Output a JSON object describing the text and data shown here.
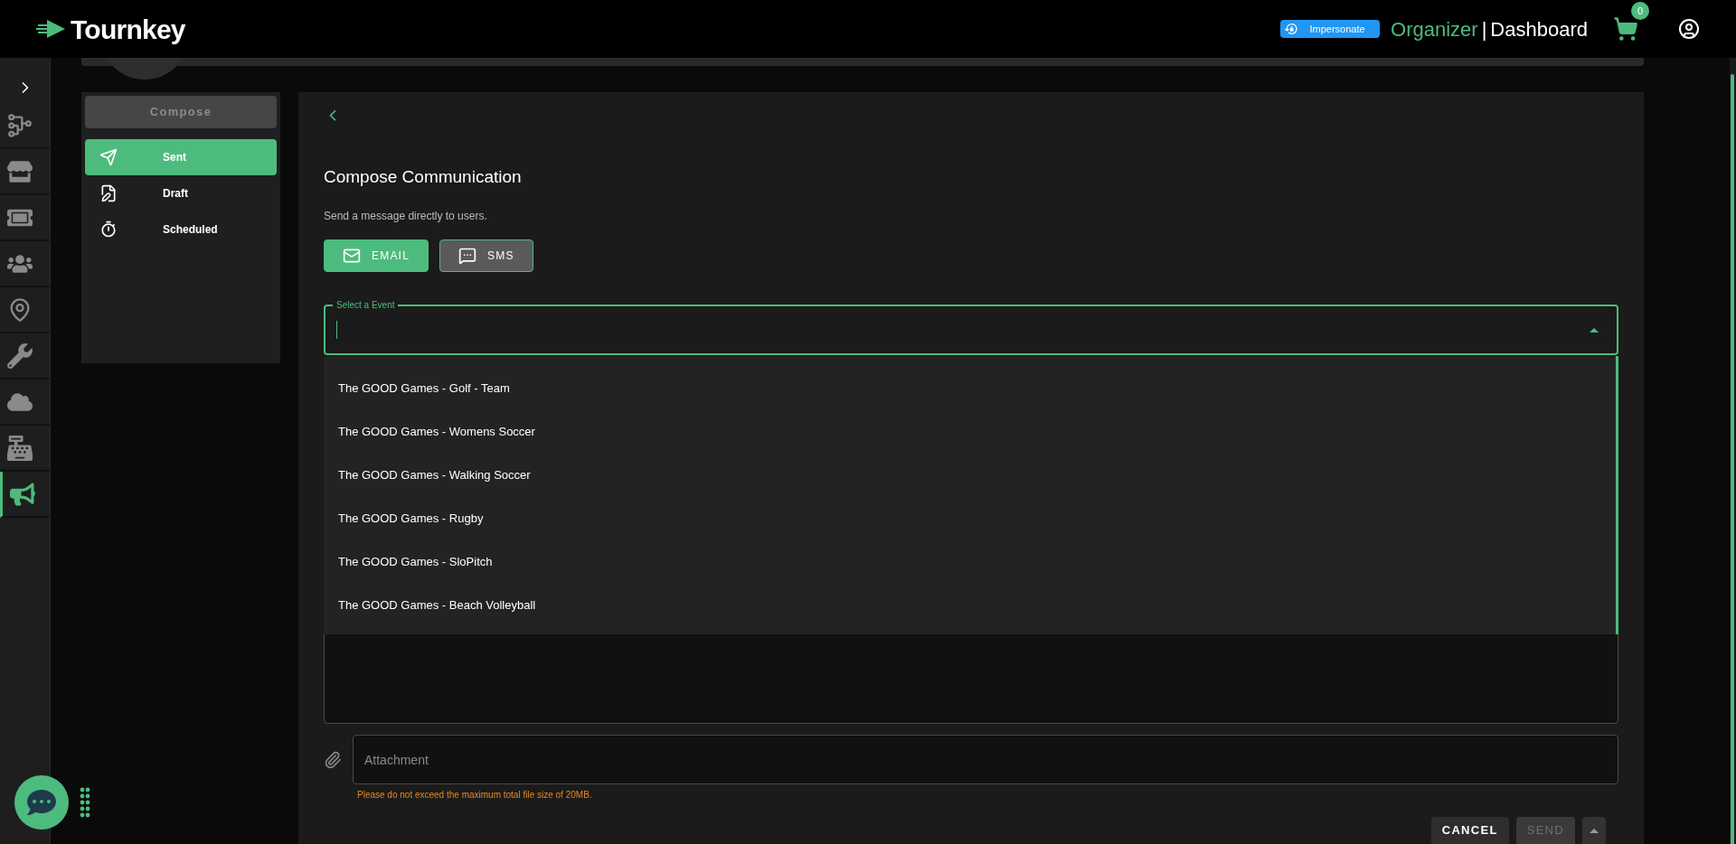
{
  "header": {
    "logo": "Tournkey",
    "impersonate": "Impersonate",
    "role": "Organizer",
    "separator": "|",
    "page": "Dashboard",
    "cart_count": "0"
  },
  "rail": [
    {
      "selected": false
    },
    {
      "selected": false
    },
    {
      "selected": false
    },
    {
      "selected": false
    },
    {
      "selected": false
    },
    {
      "selected": false
    },
    {
      "selected": false
    },
    {
      "selected": false
    },
    {
      "selected": true
    }
  ],
  "menu": {
    "compose": "Compose",
    "items": [
      {
        "label": "Sent",
        "selected": true
      },
      {
        "label": "Draft",
        "selected": false
      },
      {
        "label": "Scheduled",
        "selected": false
      }
    ]
  },
  "main": {
    "title": "Compose Communication",
    "subtitle": "Send a message directly to users.",
    "channels": [
      {
        "label": "EMAIL",
        "selected": true
      },
      {
        "label": "SMS",
        "selected": false
      }
    ],
    "event_select": {
      "label": "Select a Event",
      "expanded": true,
      "options": [
        "The GOOD Games - Golf - Team",
        "The GOOD Games - Womens Soccer",
        "The GOOD Games - Walking Soccer",
        "The GOOD Games - Rugby",
        "The GOOD Games - SloPitch",
        "The GOOD Games - Beach Volleyball"
      ]
    },
    "attachment": {
      "placeholder": "Attachment"
    },
    "warning": "Please do not exceed the maximum total file size of 20MB.",
    "buttons": [
      {
        "label": "CANCEL",
        "disabled": false
      },
      {
        "label": "SEND",
        "disabled": true
      }
    ]
  }
}
